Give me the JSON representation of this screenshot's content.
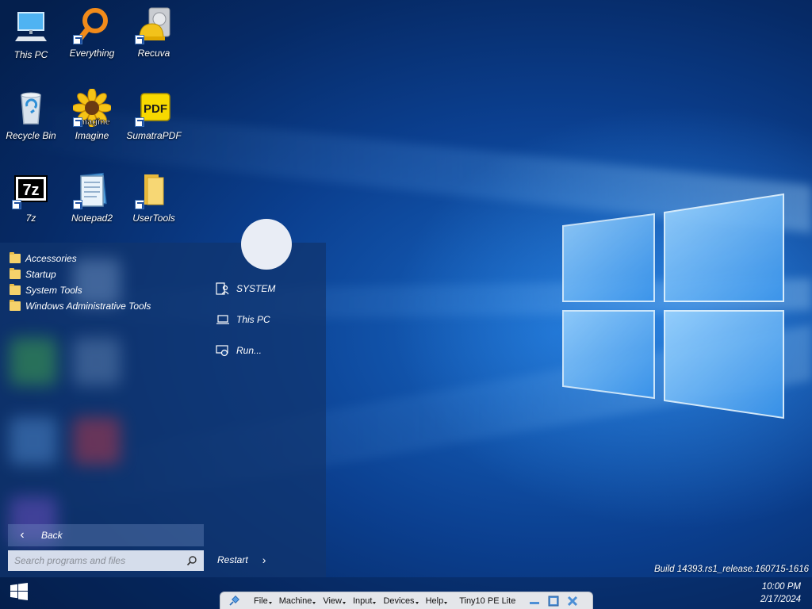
{
  "desktop": {
    "icons": [
      {
        "label": "This PC",
        "icon": "computer-icon"
      },
      {
        "label": "Everything",
        "icon": "magnifier-orange-icon"
      },
      {
        "label": "Recuva",
        "icon": "hard-drive-hardhat-icon"
      },
      {
        "label": "Recycle Bin",
        "icon": "recycle-bin-icon"
      },
      {
        "label": "Imagine",
        "icon": "sunflower-icon",
        "overlay_text": "Imagine"
      },
      {
        "label": "SumatraPDF",
        "icon": "pdf-icon",
        "overlay_text": "PDF"
      },
      {
        "label": "7z",
        "icon": "seven-zip-icon",
        "overlay_text": "7z"
      },
      {
        "label": "Notepad2",
        "icon": "notepad-icon"
      },
      {
        "label": "UserTools",
        "icon": "folder-icon"
      }
    ]
  },
  "start_menu": {
    "folders": [
      {
        "label": "Accessories"
      },
      {
        "label": "Startup"
      },
      {
        "label": "System Tools"
      },
      {
        "label": "Windows Administrative Tools"
      }
    ],
    "places": [
      {
        "label": "SYSTEM",
        "icon": "user-icon"
      },
      {
        "label": "This PC",
        "icon": "laptop-icon"
      },
      {
        "label": "Run...",
        "icon": "run-icon"
      }
    ],
    "back_label": "Back",
    "search_placeholder": "Search programs and files",
    "restart_label": "Restart"
  },
  "taskbar": {
    "build": "Build 14393.rs1_release.160715-1616",
    "time": "10:00 PM",
    "date": "2/17/2024"
  },
  "vm_bar": {
    "menus": [
      "File",
      "Machine",
      "View",
      "Input",
      "Devices",
      "Help"
    ],
    "title": "Tiny10 PE Lite"
  },
  "colors": {
    "accent": "#1766c4",
    "folder": "#f5d26b"
  }
}
